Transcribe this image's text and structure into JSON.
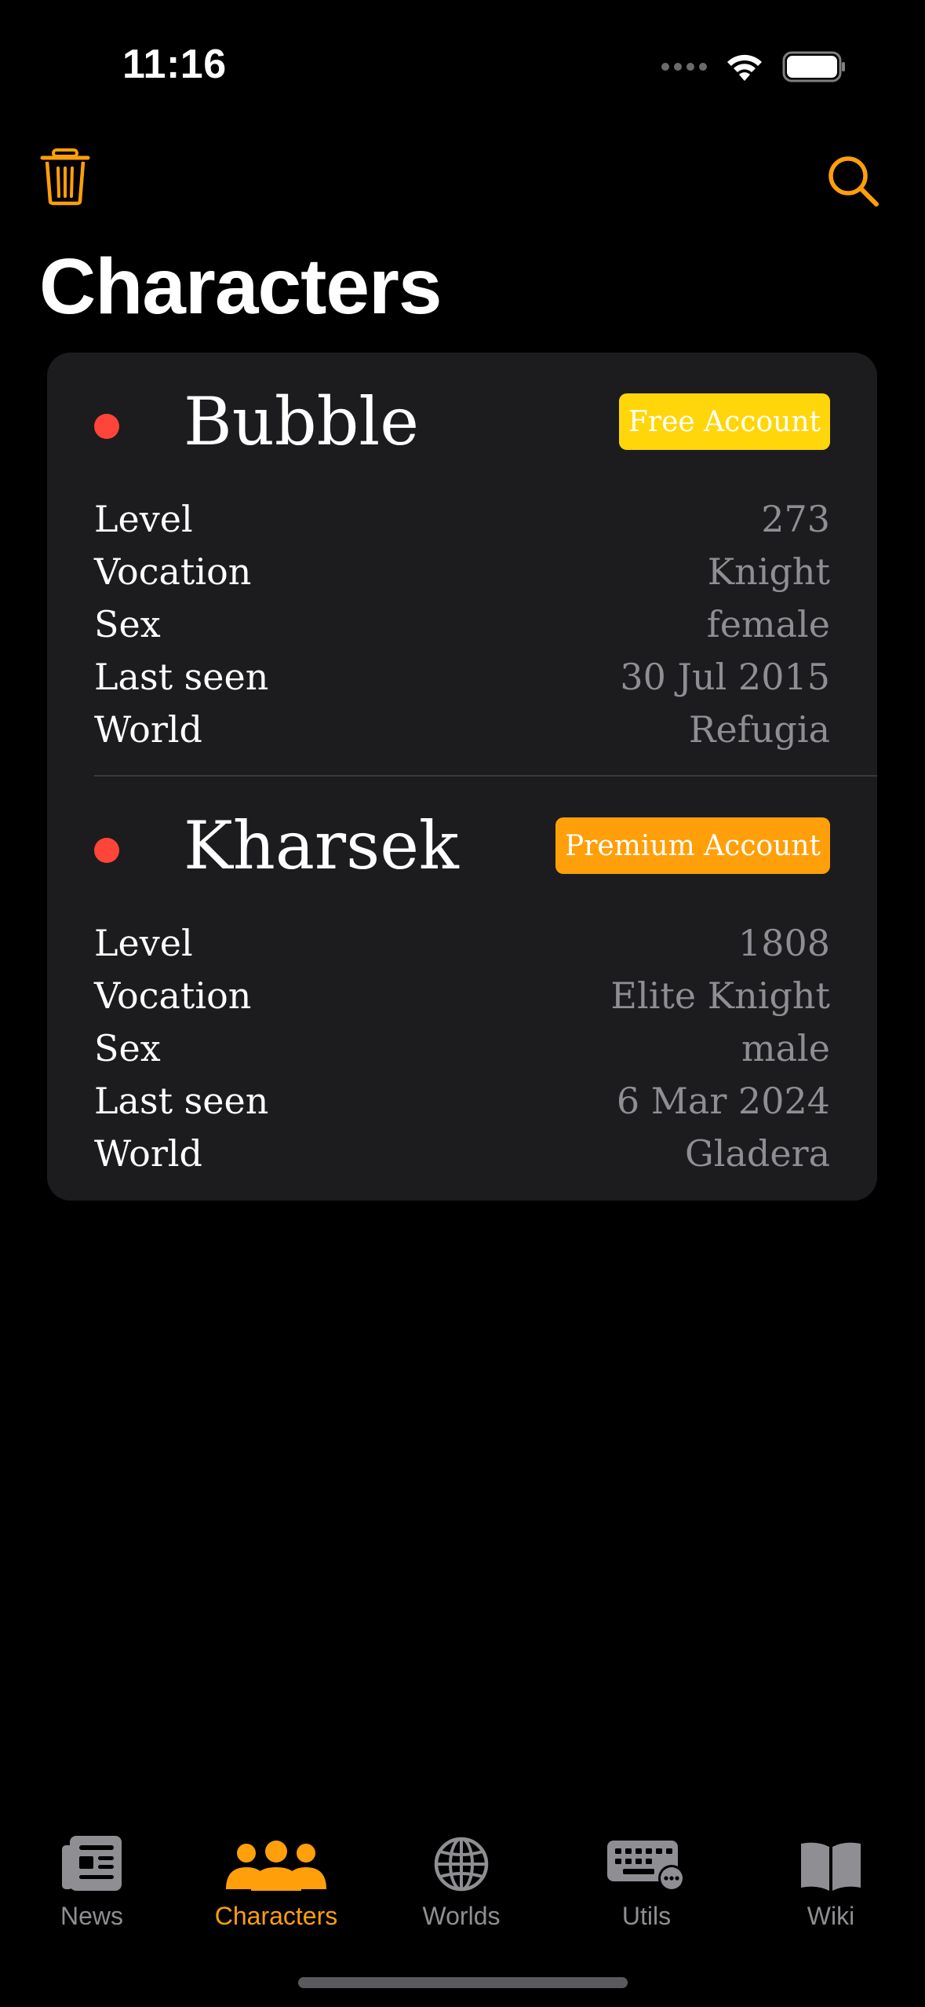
{
  "status_bar": {
    "time": "11:16"
  },
  "nav": {
    "title": "Characters",
    "trash_icon": "trash-icon",
    "search_icon": "search-icon"
  },
  "colors": {
    "accent": "#ff9f0a",
    "online_dot": "#ff453a",
    "free_badge": "#ffd60a",
    "premium_badge": "#ff9f0a",
    "card_bg": "#1c1c1e"
  },
  "characters": [
    {
      "name": "Bubble",
      "account": "Free Account",
      "rows": [
        {
          "label": "Level",
          "value": "273"
        },
        {
          "label": "Vocation",
          "value": "Knight"
        },
        {
          "label": "Sex",
          "value": "female"
        },
        {
          "label": "Last seen",
          "value": "30 Jul 2015"
        },
        {
          "label": "World",
          "value": "Refugia"
        }
      ]
    },
    {
      "name": "Kharsek",
      "account": "Premium Account",
      "rows": [
        {
          "label": "Level",
          "value": "1808"
        },
        {
          "label": "Vocation",
          "value": "Elite Knight"
        },
        {
          "label": "Sex",
          "value": "male"
        },
        {
          "label": "Last seen",
          "value": "6 Mar 2024"
        },
        {
          "label": "World",
          "value": "Gladera"
        }
      ]
    }
  ],
  "tabs": [
    {
      "label": "News",
      "icon": "newspaper-icon",
      "active": false
    },
    {
      "label": "Characters",
      "icon": "people-icon",
      "active": true
    },
    {
      "label": "Worlds",
      "icon": "globe-icon",
      "active": false
    },
    {
      "label": "Utils",
      "icon": "keyboard-icon",
      "active": false
    },
    {
      "label": "Wiki",
      "icon": "book-icon",
      "active": false
    }
  ]
}
